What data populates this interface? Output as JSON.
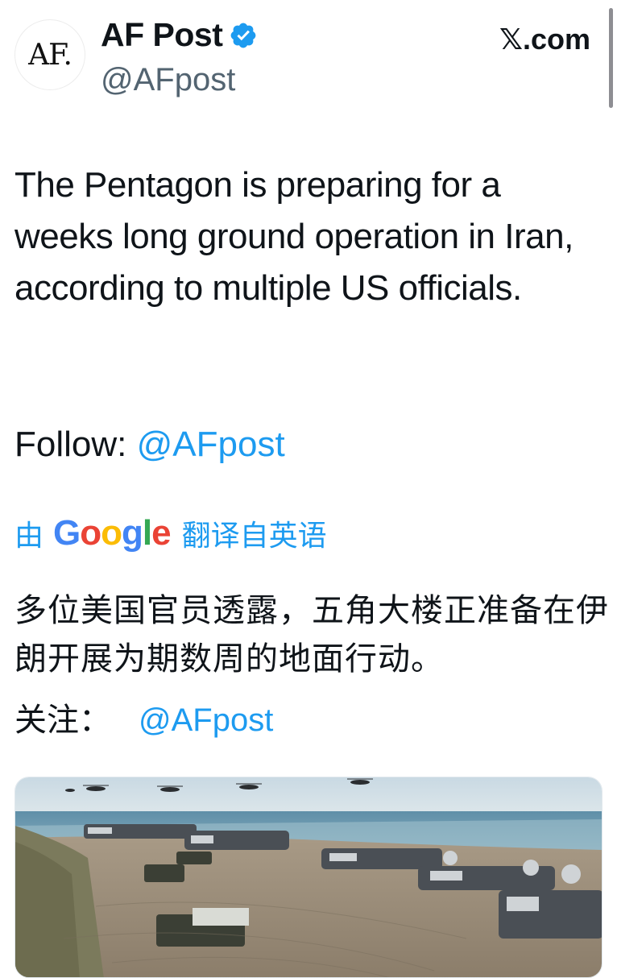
{
  "account": {
    "avatar_text": "AF.",
    "display_name": "AF Post",
    "handle": "@AFpost",
    "verified": true
  },
  "platform_logo": "𝕏.com",
  "tweet": {
    "text": "The Pentagon is preparing for a weeks long ground operation in Iran, according to multiple US officials.",
    "follow_label": "Follow:",
    "follow_handle": "@AFpost"
  },
  "translation": {
    "prefix": "由",
    "provider": "Google",
    "suffix": "翻译自英语",
    "text": "多位美国官员透露，五角大楼正准备在伊朗开展为期数周的地面行动。",
    "follow_label": "关注：",
    "follow_handle": "@AFpost"
  },
  "media": {
    "icon": "photo-beach-hovercraft-helicopters"
  },
  "colors": {
    "link": "#1d9bf0",
    "text": "#0f1419",
    "secondary": "#536471",
    "verified": "#1d9bf0"
  }
}
